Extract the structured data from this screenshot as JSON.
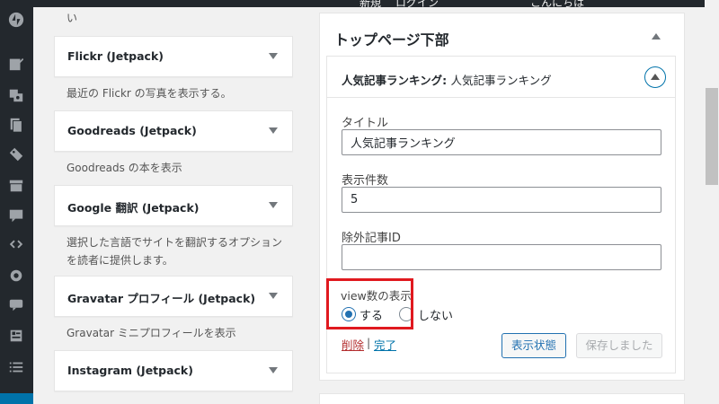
{
  "admin_bar": {
    "items": [
      "新規",
      "ログイン",
      "こんにちは"
    ]
  },
  "admin_menu": {
    "icons": [
      "jetpack-icon",
      "posts-icon",
      "media-icon",
      "pages-icon",
      "tags-icon",
      "appearance-icon",
      "comments-icon",
      "code-icon",
      "settings-icon",
      "comment-icon",
      "form-icon",
      "list-icon"
    ]
  },
  "available_widgets": {
    "top_fragment": "い",
    "items": [
      {
        "title": "Flickr (Jetpack)",
        "description": "最近の Flickr の写真を表示する。"
      },
      {
        "title": "Goodreads (Jetpack)",
        "description": "Goodreads の本を表示"
      },
      {
        "title": "Google 翻訳 (Jetpack)",
        "description": "選択した言語でサイトを翻訳するオプションを読者に提供します。"
      },
      {
        "title": "Gravatar プロフィール (Jetpack)",
        "description": "Gravatar ミニプロフィールを表示"
      },
      {
        "title": "Instagram (Jetpack)",
        "description": ""
      }
    ]
  },
  "sidebar": {
    "title": "トップページ下部"
  },
  "open_widget": {
    "title": "人気記事ランキング",
    "subtitle": "人気記事ランキング",
    "fields": {
      "title_label": "タイトル",
      "title_value": "人気記事ランキング",
      "count_label": "表示件数",
      "count_value": "5",
      "exclude_label": "除外記事ID",
      "exclude_value": ""
    },
    "views": {
      "label": "view数の表示",
      "option_yes": "する",
      "option_no": "しない",
      "selected": "する"
    },
    "actions": {
      "delete": "削除",
      "separator": "|",
      "done": "完了",
      "visibility_button": "表示状態",
      "save_button": "保存しました"
    }
  },
  "colors": {
    "admin_menu_bg": "#23282d",
    "accent": "#0073aa",
    "highlight_border": "#e0191f",
    "delete_link": "#b32d2e"
  }
}
